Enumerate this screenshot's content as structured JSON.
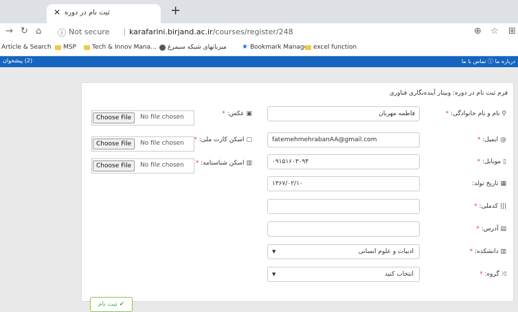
{
  "browser": {
    "tab_title": "ثبت نام در دوره",
    "tab_close": "✕",
    "new_tab": "+",
    "not_secure": "Not secure",
    "url_host": "karafarini.birjand.ac.ir",
    "url_path": "/courses/register/248"
  },
  "bookmarks": [
    {
      "label": "Article & Search",
      "icon": "none"
    },
    {
      "label": "MSP",
      "icon": "folder"
    },
    {
      "label": "Tech & Innov Mana...",
      "icon": "folder"
    },
    {
      "label": "میزبانهای شبکه سیمرغ",
      "icon": "globe"
    },
    {
      "label": "Bookmark Manager",
      "icon": "star"
    },
    {
      "label": "excel function",
      "icon": "folder"
    }
  ],
  "sitenav": {
    "left": "(2) پیشخوان",
    "right": "درباره ما ⓘ  تماس با ما"
  },
  "form": {
    "title": "فرم ثبت نام در دوره: وبینار آینده‌نگاری فناوری",
    "fields": {
      "name": {
        "label": "نام و نام خانوادگی:",
        "value": "فاطمه مهربان"
      },
      "email": {
        "label": "ایمیل:",
        "value": "fatemehmehrabanAA@gmail.com"
      },
      "mobile": {
        "label": "موبایل:",
        "value": "۰۹۱۵۱۶۰۳۰۹۴"
      },
      "birthdate": {
        "label": "تاریخ تولد:",
        "value": "۱۳۶۷/۰۲/۱۰"
      },
      "national_code": {
        "label": "کدملی:",
        "value": ""
      },
      "address": {
        "label": "آدرس:",
        "value": ""
      },
      "faculty": {
        "label": "دانشکده:",
        "value": "ادبیات و علوم انسانی"
      },
      "group": {
        "label": "گروه:",
        "value": "انتخاب کنید"
      }
    },
    "uploads": {
      "photo": {
        "label": "عکس:"
      },
      "national_card": {
        "label": "اسکن کارت ملی:"
      },
      "id_card": {
        "label": "اسکن شناسنامه:"
      }
    },
    "file_button": "Choose File",
    "file_status": "No file chosen",
    "submit": "✔ ثبت نام"
  },
  "colors": {
    "nav": "#1565c0",
    "required": "#e53935",
    "submit": "#4caf50"
  }
}
